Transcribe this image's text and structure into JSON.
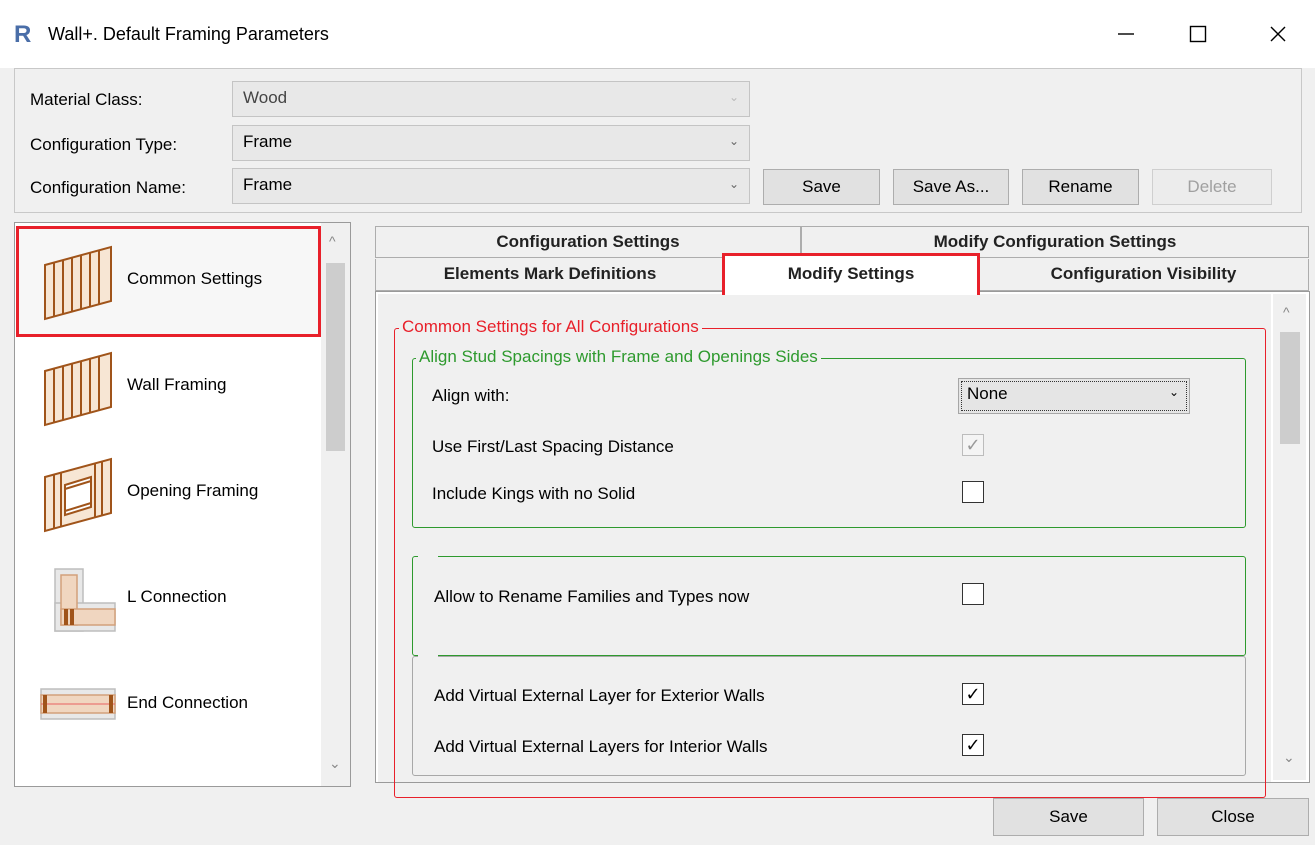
{
  "window": {
    "title": "Wall+. Default Framing Parameters",
    "app_icon_letter": "R",
    "minimize_glyph": "—",
    "maximize_glyph": "☐",
    "close_glyph": "✕"
  },
  "header": {
    "material_class": {
      "label": "Material Class:",
      "value": "Wood",
      "enabled": false
    },
    "configuration_type": {
      "label": "Configuration Type:",
      "value": "Frame"
    },
    "configuration_name": {
      "label": "Configuration Name:",
      "value": "Frame"
    },
    "buttons": {
      "save": "Save",
      "save_as": "Save As...",
      "rename": "Rename",
      "delete": "Delete"
    },
    "dropdown_arrow": "⌄"
  },
  "nav": {
    "items": [
      {
        "label": "Common Settings",
        "icon": "wall-stud-icon",
        "selected": true
      },
      {
        "label": "Wall Framing",
        "icon": "wall-stud-icon"
      },
      {
        "label": "Opening Framing",
        "icon": "opening-frame-icon"
      },
      {
        "label": "L Connection",
        "icon": "l-connection-icon"
      },
      {
        "label": "End Connection",
        "icon": "end-connection-icon"
      }
    ],
    "scroll_up": "^",
    "scroll_down": "⌄"
  },
  "tabs": {
    "row1": [
      "Configuration Settings",
      "Modify Configuration Settings"
    ],
    "row2": [
      "Elements Mark Definitions",
      "Modify Settings",
      "Configuration Visibility"
    ],
    "active": "Modify Settings"
  },
  "content": {
    "common_group_title": "Common Settings for All Configurations",
    "align_group": {
      "title": "Align Stud Spacings with Frame and Openings Sides",
      "align_with_label": "Align with:",
      "align_with_value": "None",
      "use_first_last_label": "Use First/Last Spacing Distance",
      "use_first_last_checked": true,
      "include_kings_label": "Include Kings with no Solid",
      "include_kings_checked": false
    },
    "rename_group": {
      "allow_rename_label": "Allow to Rename Families and Types now",
      "allow_rename_checked": false
    },
    "virtual_group": {
      "exterior_label": "Add Virtual External Layer for Exterior Walls",
      "exterior_checked": true,
      "interior_label": "Add Virtual External Layers for Interior Walls",
      "interior_checked": true
    },
    "check_glyph": "✓",
    "scroll_up": "^",
    "scroll_down": "⌄"
  },
  "footer": {
    "save": "Save",
    "close": "Close"
  },
  "colors": {
    "highlight_red": "#e8202a",
    "group_red": "#e8202a",
    "group_green": "#2e9a2e",
    "wood": "#a0541a"
  }
}
